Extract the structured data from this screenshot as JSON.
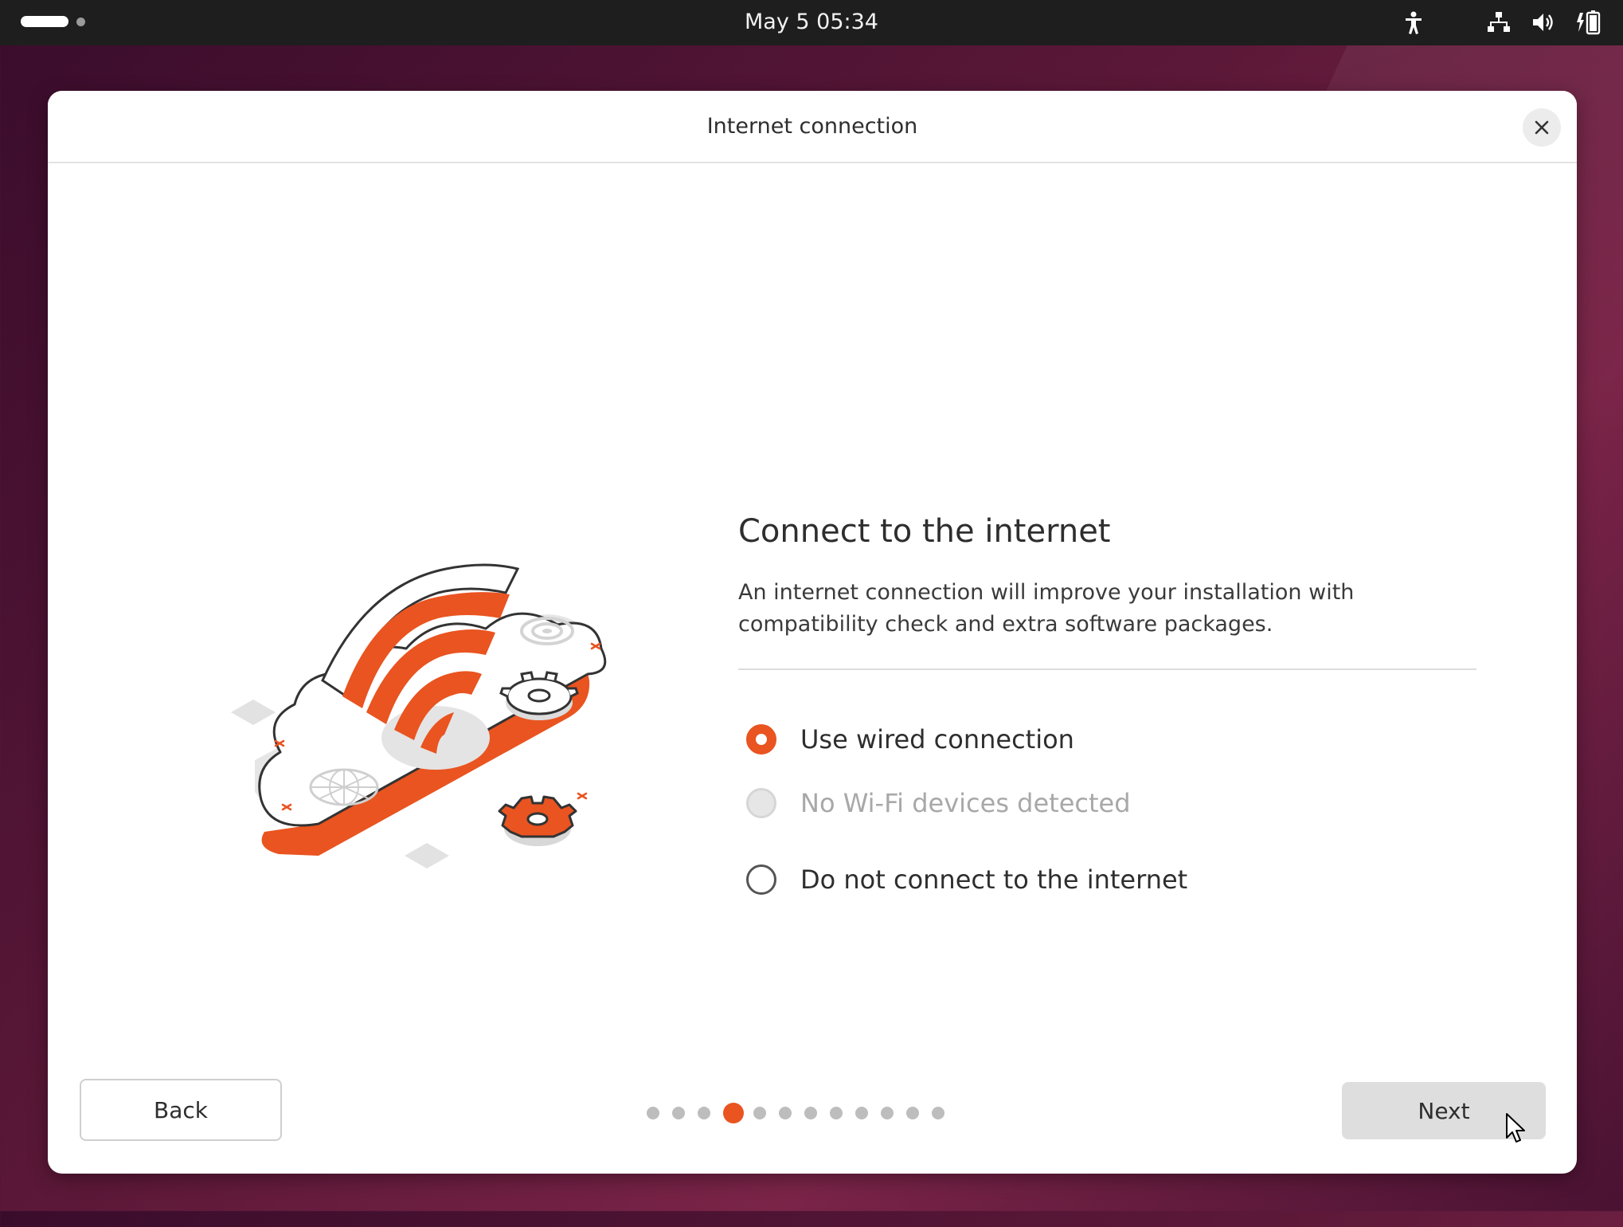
{
  "topbar": {
    "clock": "May 5  05:34",
    "tray_icons": [
      "accessibility-icon",
      "network-wired-icon",
      "volume-icon",
      "battery-icon"
    ]
  },
  "dialog": {
    "title": "Internet connection",
    "heading": "Connect to the internet",
    "description": "An internet connection will improve your installation with compatibility check and extra software packages.",
    "options": [
      {
        "label": "Use wired connection",
        "state": "selected"
      },
      {
        "label": "No Wi-Fi devices detected",
        "state": "disabled"
      },
      {
        "label": "Do not connect to the internet",
        "state": "unselected"
      }
    ],
    "back_label": "Back",
    "next_label": "Next",
    "pager": {
      "total_steps": 13,
      "current_step": 4
    }
  },
  "colors": {
    "accent": "#e95420",
    "topbar_bg": "#1e1e1e",
    "dialog_bg": "#ffffff"
  }
}
